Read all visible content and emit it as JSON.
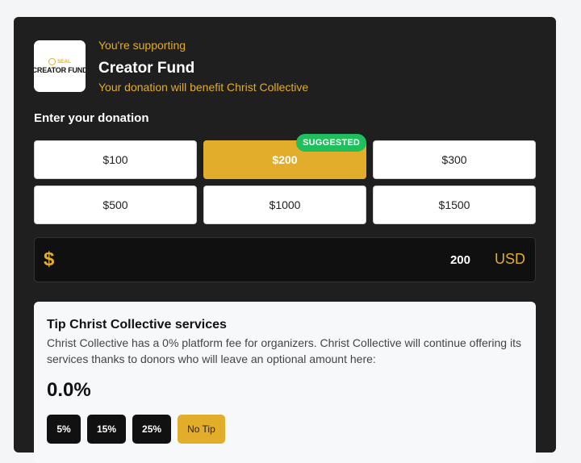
{
  "header": {
    "logo_text": "CREATOR FUND",
    "logo_seal_text": "SEAL",
    "supporting_label": "You're supporting",
    "fund_name": "Creator Fund",
    "benefit_text": "Your donation will benefit Christ Collective"
  },
  "donation": {
    "label": "Enter your donation",
    "suggested_badge": "SUGGESTED",
    "amounts": [
      "$100",
      "$200",
      "$300",
      "$500",
      "$1000",
      "$1500"
    ],
    "selected": "$200",
    "input": {
      "symbol": "$",
      "value": "200",
      "currency": "USD"
    }
  },
  "tip": {
    "title": "Tip Christ Collective services",
    "description": "Christ Collective has a 0% platform fee for organizers. Christ Collective will continue offering its services thanks to donors who will leave an optional amount here:",
    "percent": "0.0%",
    "options": [
      "5%",
      "15%",
      "25%",
      "No Tip"
    ],
    "selected": "No Tip"
  },
  "colors": {
    "accent": "#e2ad2b",
    "card_bg": "#1f1f1f",
    "badge_green": "#1fbf5d"
  }
}
